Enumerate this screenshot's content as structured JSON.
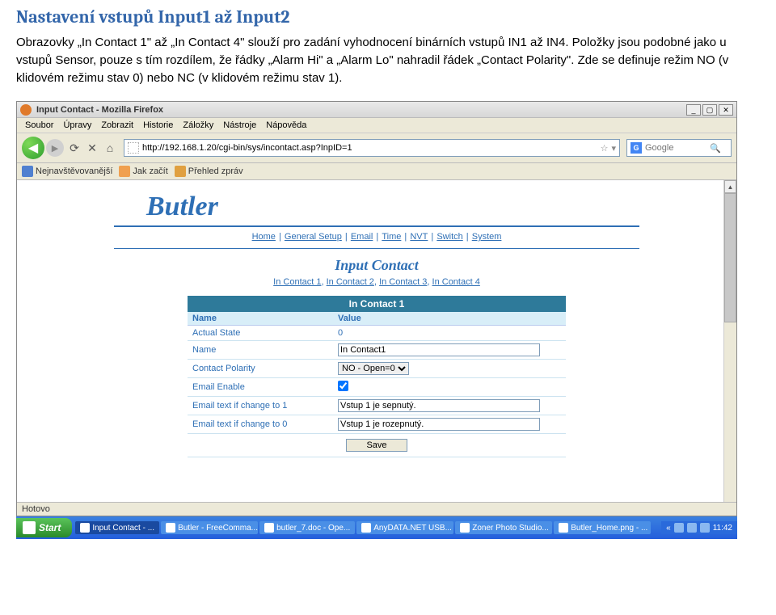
{
  "doc": {
    "heading": "Nastavení vstupů Input1 až Input2",
    "body": "Obrazovky „In Contact 1\" až „In Contact 4\" slouží pro zadání vyhodnocení binárních vstupů IN1 až IN4. Položky jsou podobné jako u vstupů Sensor, pouze s tím rozdílem, že řádky „Alarm Hi\" a „Alarm Lo\" nahradil řádek „Contact Polarity\". Zde se definuje režim NO (v klidovém režimu stav 0) nebo NC (v klidovém režimu stav 1)."
  },
  "browser": {
    "title": "Input Contact - Mozilla Firefox",
    "menus": [
      "Soubor",
      "Úpravy",
      "Zobrazit",
      "Historie",
      "Záložky",
      "Nástroje",
      "Nápověda"
    ],
    "url": "http://192.168.1.20/cgi-bin/sys/incontact.asp?InpID=1",
    "search_placeholder": "Google",
    "bookmarks": [
      {
        "label": "Nejnavštěvovanější"
      },
      {
        "label": "Jak začít"
      },
      {
        "label": "Přehled zpráv"
      }
    ],
    "status": "Hotovo",
    "window_controls": {
      "min": "_",
      "max": "▢",
      "close": "✕"
    }
  },
  "page": {
    "brand": "Butler",
    "topnav": [
      "Home",
      "General Setup",
      "Email",
      "Time",
      "NVT",
      "Switch",
      "System"
    ],
    "section_title": "Input Contact",
    "subnav": [
      "In Contact 1",
      "In Contact 2",
      "In Contact 3",
      "In Contact 4"
    ],
    "form_header": "In Contact 1",
    "col_name": "Name",
    "col_value": "Value",
    "rows": {
      "actual_state": {
        "label": "Actual State",
        "value": "0"
      },
      "name": {
        "label": "Name",
        "value": "In Contact1"
      },
      "polarity": {
        "label": "Contact Polarity",
        "value": "NO - Open=0"
      },
      "email_enable": {
        "label": "Email Enable",
        "checked": true
      },
      "text1": {
        "label": "Email text if change to 1",
        "value": "Vstup 1 je sepnutý."
      },
      "text0": {
        "label": "Email text if change to 0",
        "value": "Vstup 1 je rozepnutý."
      }
    },
    "save_label": "Save"
  },
  "taskbar": {
    "start": "Start",
    "items": [
      "Input Contact - ...",
      "Butler - FreeComma...",
      "butler_7.doc - Ope...",
      "AnyDATA.NET USB...",
      "Zoner Photo Studio...",
      "Butler_Home.png - ..."
    ],
    "tray_prefix": "«",
    "clock": "11:42"
  }
}
